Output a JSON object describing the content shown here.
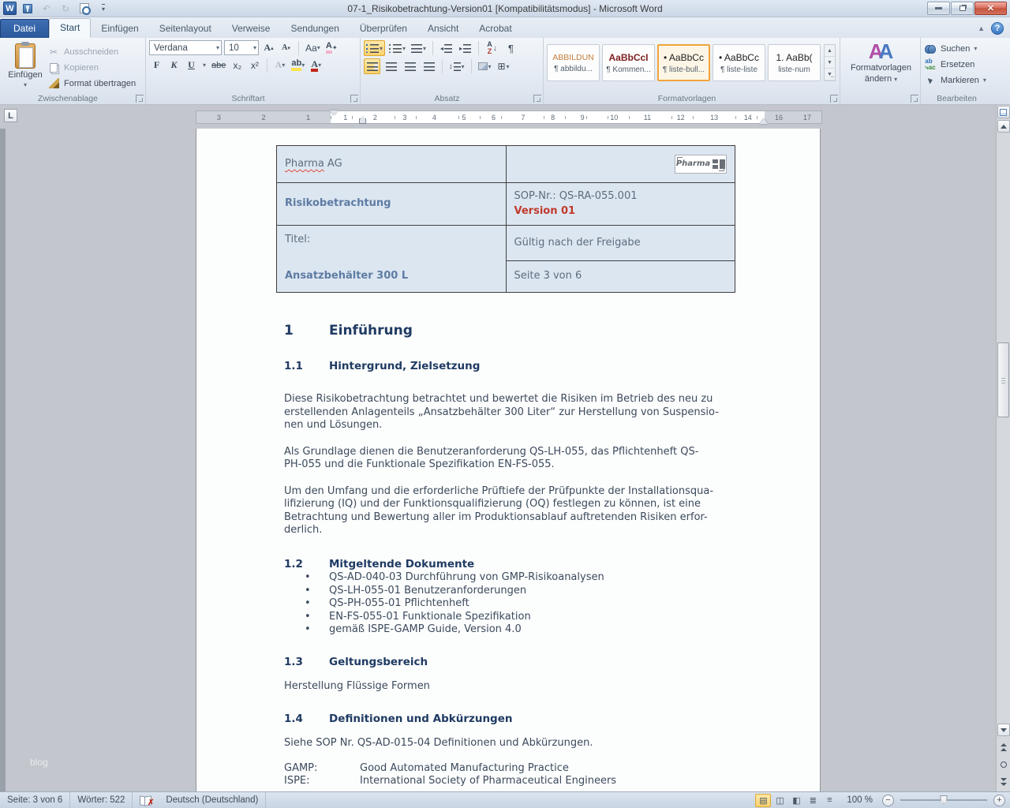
{
  "window": {
    "title": "07-1_Risikobetrachtung-Version01 [Kompatibilitätsmodus]  -  Microsoft Word",
    "word_logo": "W"
  },
  "ribbon": {
    "file_tab": "Datei",
    "tabs": [
      "Start",
      "Einfügen",
      "Seitenlayout",
      "Verweise",
      "Sendungen",
      "Überprüfen",
      "Ansicht",
      "Acrobat"
    ],
    "clipboard": {
      "label": "Zwischenablage",
      "paste": "Einfügen",
      "cut": "Ausschneiden",
      "copy": "Kopieren",
      "format_painter": "Format übertragen"
    },
    "font": {
      "label": "Schriftart",
      "font_name": "Verdana",
      "font_size": "10",
      "bold": "F",
      "italic": "K",
      "underline": "U",
      "strike": "abe",
      "subscript": "x₂",
      "superscript": "x²",
      "grow": "A",
      "shrink": "A",
      "case": "Aa",
      "effects": "A",
      "highlight": "ab",
      "color": "A"
    },
    "paragraph": {
      "label": "Absatz",
      "sort_a": "A",
      "sort_z": "Z",
      "pilcrow": "¶"
    },
    "styles": {
      "label": "Formatvorlagen",
      "items": [
        {
          "preview": "ABBILDUN",
          "name": "¶ abbildu..."
        },
        {
          "preview": "AaBbCcI",
          "name": "¶ Kommen..."
        },
        {
          "preview": "• AaBbCc",
          "name": "¶ liste-bull..."
        },
        {
          "preview": "• AaBbCc",
          "name": "¶ liste-liste"
        },
        {
          "preview": "1. AaBb(",
          "name": "liste-num"
        }
      ],
      "preview_colors": {
        "0": "#c07d3d",
        "1": "#7d1f1f"
      }
    },
    "change_styles": {
      "label": "Formatvorlagen ändern",
      "icon_a1": "A",
      "icon_a2": "A"
    },
    "editing": {
      "label": "Bearbeiten",
      "find": "Suchen",
      "replace": "Ersetzen",
      "replace_icon": "ab ac",
      "select": "Markieren"
    }
  },
  "ruler": {
    "tab_selector": "L",
    "margin_left_numbers": [
      "3",
      "2",
      "1"
    ],
    "numbers": [
      "1",
      "2",
      "3",
      "4",
      "5",
      "6",
      "7",
      "8",
      "9",
      "10",
      "11",
      "12",
      "13",
      "14"
    ],
    "margin_right_numbers": [
      "16",
      "17"
    ]
  },
  "document": {
    "header_table": {
      "company_word": "Pharma",
      "company_suffix": " AG",
      "doc_type": "Risikobetrachtung",
      "sop_nr": "SOP-Nr.: QS-RA-055.001",
      "version": "Version 01",
      "title_label": "Titel:",
      "title": "Ansatzbehälter 300 L",
      "validity": "Gültig nach der Freigabe",
      "page_info": "Seite 3 von 6",
      "logo_text": "Pharma"
    },
    "h1_num": "1",
    "h1_text": "Einführung",
    "s11_num": "1.1",
    "s11_title": "Hintergrund, Zielsetzung",
    "p1": "Diese Risikobetrachtung  betrachtet und bewertet die Risiken im Betrieb des neu zu\nerstellenden Anlagenteils „Ansatzbehälter 300 Liter“ zur Herstellung  von Suspensio-\nnen und Lösungen.",
    "p2": "Als Grundlage dienen die Benutzeranforderung QS-LH-055,  das Pflichtenheft QS-\nPH-055 und die Funktionale Spezifikation EN-FS-055.",
    "p3": "Um den Umfang und die erforderliche Prüftiefe der Prüfpunkte der Installationsqua-\nlifizierung (IQ) und der Funktionsqualifizierung  (OQ) festlegen zu können, ist eine\nBetrachtung und Bewertung aller im Produktionsablauf  auftretenden Risiken erfor-\nderlich.",
    "s12_num": "1.2",
    "s12_title": "Mitgeltende Dokumente",
    "bullets": [
      "QS-AD-040-03  Durchführung von GMP-Risikoanalysen",
      "QS-LH-055-01  Benutzeranforderungen",
      "QS-PH-055-01  Pflichtenheft",
      "EN-FS-055-01  Funktionale  Spezifikation",
      "gemäß ISPE-GAMP  Guide,  Version 4.0"
    ],
    "s13_num": "1.3",
    "s13_title": "Geltungsbereich",
    "s13_text": "Herstellung  Flüssige  Formen",
    "s14_num": "1.4",
    "s14_title": "Definitionen und Abkürzungen",
    "s14_text": "Siehe SOP Nr. QS-AD-015-04  Definitionen  und Abkürzungen.",
    "definitions": [
      {
        "term": "GAMP:",
        "def": "Good Automated  Manufacturing  Practice"
      },
      {
        "term": "ISPE:",
        "def": "International  Society  of Pharmaceutical  Engineers"
      }
    ],
    "watermark": "blog"
  },
  "status_bar": {
    "page": "Seite: 3 von 6",
    "words": "Wörter: 522",
    "language": "Deutsch (Deutschland)",
    "zoom": "100 %"
  }
}
